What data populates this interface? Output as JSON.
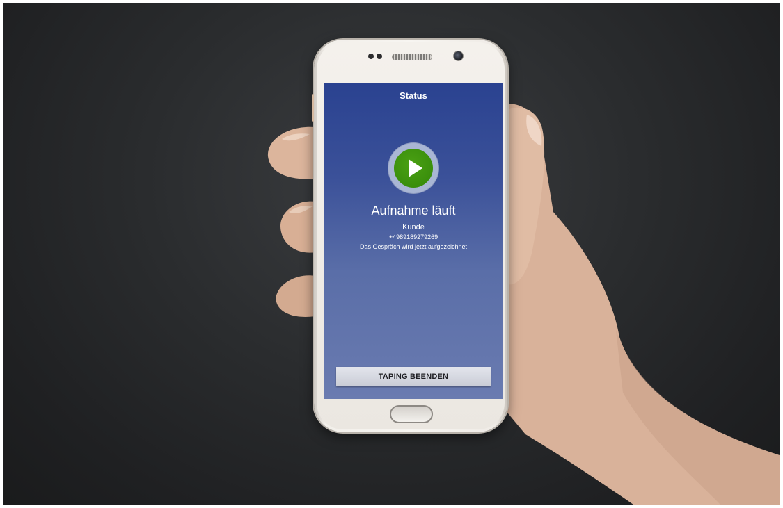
{
  "app": {
    "header_title": "Status"
  },
  "recording": {
    "state_icon": "play-icon",
    "headline": "Aufnahme läuft",
    "contact_label": "Kunde",
    "phone_number": "+4989189279269",
    "note": "Das Gespräch wird jetzt aufgezeichnet",
    "indicator_color": "#3a8f0c",
    "indicator_ring_color": "#a9b6d4"
  },
  "actions": {
    "stop_label": "TAPING BEENDEN"
  },
  "colors": {
    "screen_top": "#2a4290",
    "screen_bottom": "#6a7bb0",
    "button_bg": "#d6d8e0",
    "photo_background": "#2a2c2e"
  }
}
